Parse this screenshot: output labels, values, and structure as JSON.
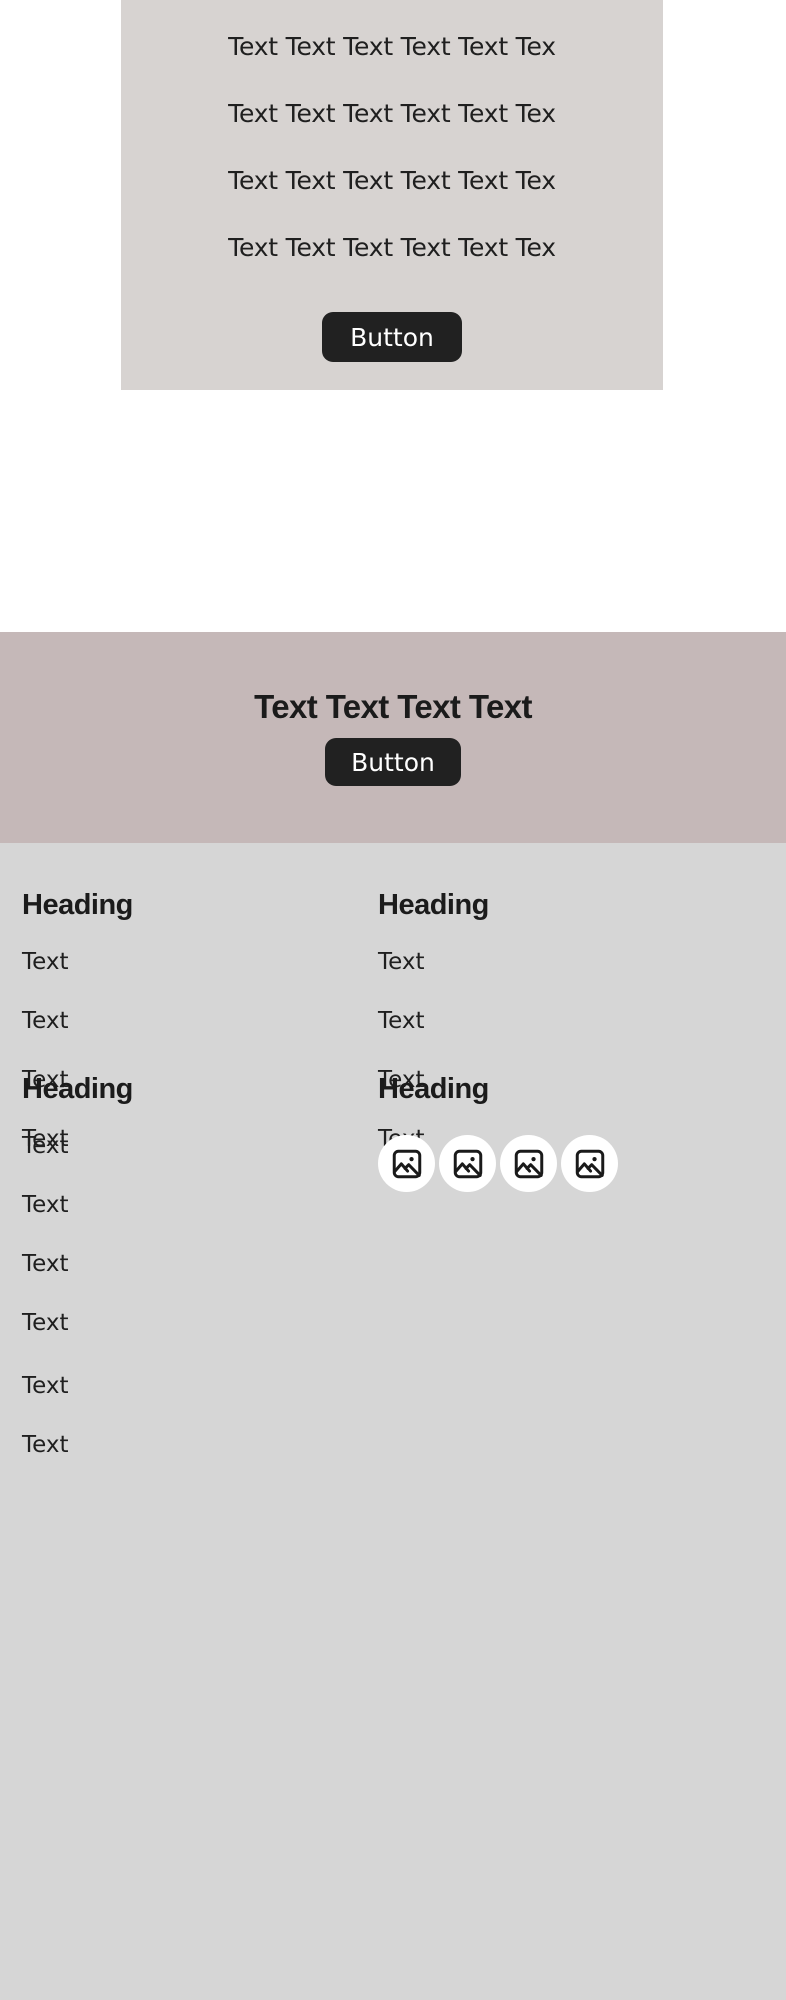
{
  "hero": {
    "lines": [
      "Text Text Text Text Text Tex",
      "Text Text Text Text Text Tex",
      "Text Text Text Text Text Tex",
      "Text Text Text Text Text Tex"
    ],
    "button_label": "Button",
    "background_color": "#D7D3D1"
  },
  "banner": {
    "title": "Text Text Text Text",
    "button_label": "Button",
    "background_color": "#C5B8B8"
  },
  "footer": {
    "background_color": "#D6D6D6",
    "columns": [
      {
        "heading": "Heading",
        "links": [
          "Text",
          "Text",
          "Text",
          "Text"
        ]
      },
      {
        "heading": "Heading",
        "links": [
          "Text",
          "Text",
          "Text",
          "Text"
        ]
      },
      {
        "heading": "Heading",
        "links": [
          "Text",
          "Text",
          "Text",
          "Text"
        ]
      },
      {
        "heading": "Heading",
        "links": [],
        "icons": [
          "image-icon",
          "image-icon",
          "image-icon",
          "image-icon"
        ]
      }
    ],
    "extra_links": [
      "Text",
      "Text"
    ]
  }
}
